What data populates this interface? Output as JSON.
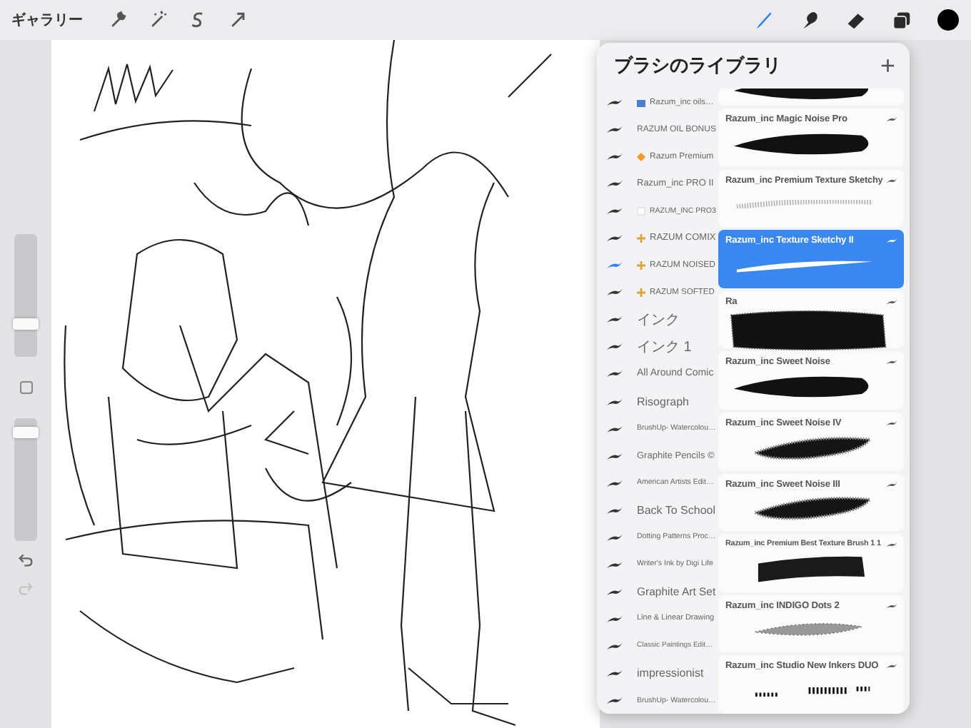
{
  "top_bar": {
    "gallery": "ギャラリー",
    "left_tools": [
      {
        "kind": "wrench"
      },
      {
        "kind": "wand"
      },
      {
        "kind": "select"
      },
      {
        "kind": "move"
      }
    ],
    "right_tools": [
      {
        "kind": "brush",
        "selected": true
      },
      {
        "kind": "smudge",
        "selected": false
      },
      {
        "kind": "eraser",
        "selected": false
      },
      {
        "kind": "layers",
        "selected": false
      },
      {
        "kind": "color",
        "selected": false
      }
    ]
  },
  "sidebar": {
    "size_slider": {
      "level": 0.25
    },
    "opacity_slider": {
      "level": 0.92
    },
    "redo_disabled": true
  },
  "brush_library": {
    "title": "ブラシのライブラリ",
    "add": "+",
    "sets": [
      {
        "name": "Razum_inc oils…",
        "kind": "picture",
        "selected": false
      },
      {
        "name": "RAZUM OIL BONUS",
        "selected": false
      },
      {
        "name": "Razum Premium",
        "kind": "diamond",
        "selected": false
      },
      {
        "name": "Razum_inc PRO II",
        "selected": false
      },
      {
        "name": "RAZUM_INC PRO3",
        "kind": "blank",
        "selected": false
      },
      {
        "name": "RAZUM COMIX",
        "kind": "plus",
        "selected": false
      },
      {
        "name": "RAZUM NOISED",
        "kind": "plus",
        "selected": true
      },
      {
        "name": "RAZUM SOFTED",
        "kind": "plus",
        "selected": false
      },
      {
        "name": "インク",
        "selected": false
      },
      {
        "name": "インク 1",
        "selected": false
      },
      {
        "name": "All Around Comic",
        "selected": false
      },
      {
        "name": "Risograph",
        "selected": false
      },
      {
        "name": "BrushUp- Watercolou…",
        "selected": false
      },
      {
        "name": "Graphite Pencils ©",
        "selected": false
      },
      {
        "name": "American Artists Edit…",
        "selected": false
      },
      {
        "name": "Back To School",
        "selected": false
      },
      {
        "name": "Dotting Patterns Proc…",
        "selected": false
      },
      {
        "name": "Writer's Ink by Digi Life",
        "selected": false
      },
      {
        "name": "Graphite Art Set",
        "selected": false
      },
      {
        "name": "Line & Linear Drawing",
        "selected": false
      },
      {
        "name": "Classic Paintings Edit…",
        "selected": false
      },
      {
        "name": "impressionist",
        "selected": false
      },
      {
        "name": "BrushUp- Watercolou…",
        "selected": false
      }
    ],
    "brushes": [
      {
        "kind": "taper",
        "selected": false
      },
      {
        "name": "Razum_inc Magic Noise Pro",
        "kind": "taper",
        "selected": false
      },
      {
        "name": "Razum_inc Premium Texture Sketchy",
        "kind": "grain",
        "selected": false
      },
      {
        "name": "Razum_inc Texture Sketchy  II",
        "kind": "sketch",
        "selected": true
      },
      {
        "name": "Ra",
        "kind": "noise",
        "selected": false
      },
      {
        "name": "Razum_inc Sweet Noise",
        "kind": "taper",
        "selected": false
      },
      {
        "name": "Razum_inc Sweet Noise IV",
        "kind": "soft",
        "selected": false
      },
      {
        "name": "Razum_inc Sweet Noise III",
        "kind": "soft",
        "selected": false
      },
      {
        "name": "Razum_inc Premium Best Texture Brush 1 1",
        "kind": "band",
        "selected": false
      },
      {
        "name": "Razum_inc INDIGO Dots 2",
        "kind": "dots",
        "selected": false
      },
      {
        "name": "Razum_inc Studio New Inkers DUO",
        "kind": "spatter",
        "selected": false
      }
    ]
  }
}
